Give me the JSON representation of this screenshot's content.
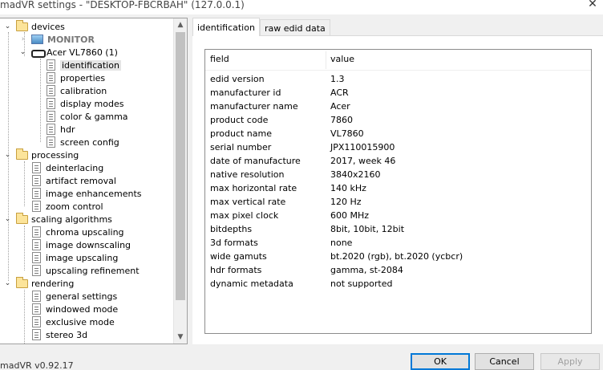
{
  "window": {
    "title": "madVR settings - \"DESKTOP-FBCRBAH\" (127.0.0.1)",
    "close_glyph": "✕"
  },
  "tree": {
    "devices": "devices",
    "monitor": "MONITOR",
    "device_name": "Acer VL7860 (1)",
    "device_items": [
      "identification",
      "properties",
      "calibration",
      "display modes",
      "color & gamma",
      "hdr",
      "screen config"
    ],
    "processing": "processing",
    "processing_items": [
      "deinterlacing",
      "artifact removal",
      "image enhancements",
      "zoom control"
    ],
    "scaling": "scaling algorithms",
    "scaling_items": [
      "chroma upscaling",
      "image downscaling",
      "image upscaling",
      "upscaling refinement"
    ],
    "rendering": "rendering",
    "rendering_items": [
      "general settings",
      "windowed mode",
      "exclusive mode",
      "stereo 3d"
    ],
    "expanded_glyph": "⌄",
    "collapsed_glyph": "›",
    "scroll_up": "▲",
    "scroll_down": "▼"
  },
  "tabs": [
    "identification",
    "raw edid data"
  ],
  "table": {
    "headers": [
      "field",
      "value"
    ],
    "rows": [
      [
        "edid version",
        "1.3"
      ],
      [
        "manufacturer id",
        "ACR"
      ],
      [
        "manufacturer name",
        "Acer"
      ],
      [
        "product code",
        "7860"
      ],
      [
        "product name",
        "VL7860"
      ],
      [
        "serial number",
        "JPX110015900"
      ],
      [
        "date of manufacture",
        "2017, week 46"
      ],
      [
        "native resolution",
        "3840x2160"
      ],
      [
        "max horizontal rate",
        "140 kHz"
      ],
      [
        "max vertical rate",
        "120 Hz"
      ],
      [
        "max pixel clock",
        "600 MHz"
      ],
      [
        "bitdepths",
        "8bit, 10bit, 12bit"
      ],
      [
        "3d formats",
        "none"
      ],
      [
        "wide gamuts",
        "bt.2020 (rgb), bt.2020 (ycbcr)"
      ],
      [
        "hdr formats",
        "gamma, st-2084"
      ],
      [
        "dynamic metadata",
        "not supported"
      ]
    ]
  },
  "footer": {
    "version": "madVR v0.92.17",
    "ok": "OK",
    "cancel": "Cancel",
    "apply": "Apply"
  }
}
